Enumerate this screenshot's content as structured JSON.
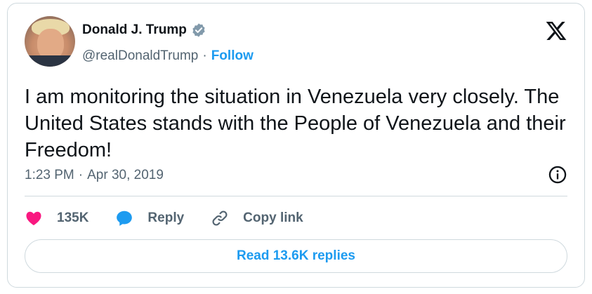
{
  "author": {
    "name": "Donald J. Trump",
    "handle": "@realDonaldTrump",
    "separator": "·",
    "follow_label": "Follow",
    "verified": true
  },
  "tweet": {
    "text": "I am monitoring the situation in Venezuela very closely. The United States stands with the People of Venezuela and their Freedom!",
    "time": "1:23 PM",
    "separator": "·",
    "date": "Apr 30, 2019"
  },
  "actions": {
    "like_count": "135K",
    "reply_label": "Reply",
    "copy_label": "Copy link"
  },
  "read_replies_label": "Read 13.6K replies",
  "colors": {
    "accent": "#1d9bf0",
    "like": "#f91880",
    "verified": "#829aab",
    "text": "#0f1419",
    "muted": "#536471",
    "border": "#cfd9de"
  },
  "icons": [
    "verified-badge-icon",
    "x-logo-icon",
    "info-icon",
    "heart-icon",
    "reply-bubble-icon",
    "link-icon"
  ]
}
